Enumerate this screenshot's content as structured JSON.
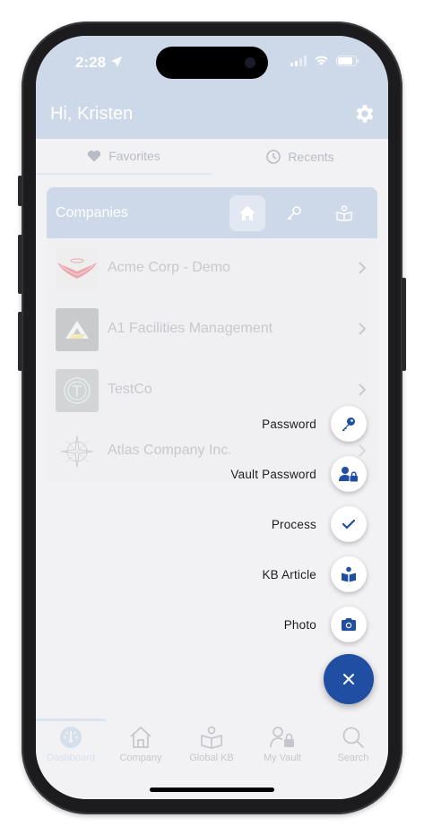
{
  "status": {
    "time": "2:28"
  },
  "header": {
    "greeting": "Hi, Kristen"
  },
  "tabs": [
    {
      "label": "Favorites",
      "icon": "heart-icon",
      "active": true
    },
    {
      "label": "Recents",
      "icon": "clock-icon",
      "active": false
    }
  ],
  "companies": {
    "title": "Companies",
    "items": [
      {
        "name": "Acme Corp - Demo",
        "logo": "acme-wings-logo"
      },
      {
        "name": "A1 Facilities Management",
        "logo": "a1-logo"
      },
      {
        "name": "TestCo",
        "logo": "testco-logo"
      },
      {
        "name": "Atlas Company Inc.",
        "logo": "atlas-compass-logo"
      }
    ]
  },
  "fab_menu": {
    "items": [
      {
        "label": "Password",
        "icon": "key-icon"
      },
      {
        "label": "Vault Password",
        "icon": "user-lock-icon"
      },
      {
        "label": "Process",
        "icon": "check-icon"
      },
      {
        "label": "KB Article",
        "icon": "book-reader-icon"
      },
      {
        "label": "Photo",
        "icon": "camera-icon"
      }
    ],
    "close_icon": "close-icon"
  },
  "tabbar": {
    "items": [
      {
        "label": "Dashboard",
        "icon": "dashboard-gauge-icon",
        "active": true
      },
      {
        "label": "Company",
        "icon": "house-icon",
        "active": false
      },
      {
        "label": "Global KB",
        "icon": "book-reader-icon",
        "active": false
      },
      {
        "label": "My Vault",
        "icon": "user-lock-icon",
        "active": false
      },
      {
        "label": "Search",
        "icon": "search-icon",
        "active": false
      }
    ]
  },
  "colors": {
    "accent": "#1f4ea3",
    "header": "#cdd8e8",
    "background": "#f2f2f4"
  }
}
